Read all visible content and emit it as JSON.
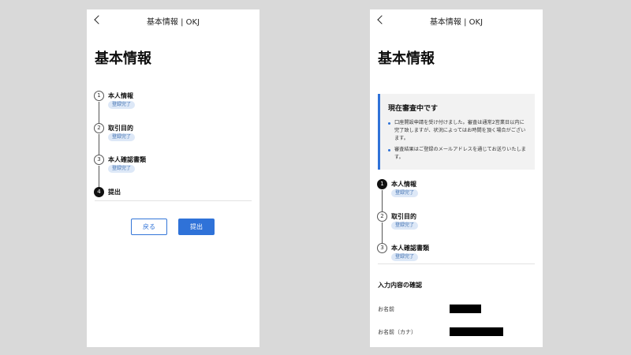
{
  "colors": {
    "background": "#d9d9d9",
    "accent": "#2f72d8",
    "badge_bg": "#dde8f7",
    "badge_text": "#3f6fb0"
  },
  "left_screen": {
    "header": {
      "back_icon": "chevron-left-icon",
      "title": "基本情報 | OKJ"
    },
    "page_title": "基本情報",
    "steps": [
      {
        "number": "1",
        "label": "本人情報",
        "badge": "登録完了"
      },
      {
        "number": "2",
        "label": "取引目的",
        "badge": "登録完了"
      },
      {
        "number": "3",
        "label": "本人確認書類",
        "badge": "登録完了"
      },
      {
        "number": "4",
        "label": "提出",
        "active": true
      }
    ],
    "buttons": {
      "back_label": "戻る",
      "submit_label": "提出"
    }
  },
  "right_screen": {
    "header": {
      "back_icon": "chevron-left-icon",
      "title": "基本情報 | OKJ"
    },
    "page_title": "基本情報",
    "notice": {
      "title": "現在審査中です",
      "items": [
        "口座開設申請を受け付けました。審査は通常2営業日以内に完了致しますが、状況によってはお時間を頂く場合がございます。",
        "審査結果はご登録のメールアドレスを通じてお送りいたします。"
      ]
    },
    "steps": [
      {
        "number": "1",
        "label": "本人情報",
        "badge": "登録完了",
        "active": true
      },
      {
        "number": "2",
        "label": "取引目的",
        "badge": "登録完了"
      },
      {
        "number": "3",
        "label": "本人確認書類",
        "badge": "登録完了"
      }
    ],
    "confirmation": {
      "title": "入力内容の確認",
      "fields": [
        {
          "label": "お名前"
        },
        {
          "label": "お名前（カナ）"
        }
      ]
    }
  }
}
